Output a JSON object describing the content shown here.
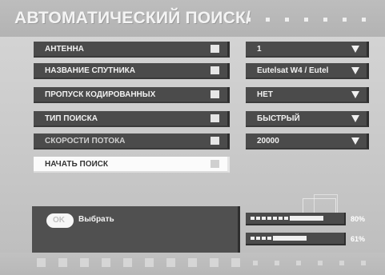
{
  "screen": {
    "title": "АВТОМАТИЧЕСКИЙ ПОИСК/"
  },
  "settings": [
    {
      "label": "АНТЕННА",
      "value": "1"
    },
    {
      "label": "НАЗВАНИЕ СПУТНИКА",
      "value": "Eutelsat W4 / Eutel"
    },
    {
      "label": "ПРОПУСК КОДИРОВАННЫХ",
      "value": "НЕТ"
    },
    {
      "label": "ТИП ПОИСКА",
      "value": "БЫСТРЫЙ"
    },
    {
      "label": "СКОРОСТИ ПОТОКА",
      "value": "20000"
    }
  ],
  "start_button": {
    "label": "НАЧАТЬ ПОИСК"
  },
  "ok_panel": {
    "ok_key": "OK",
    "action_label": "Выбрать"
  },
  "signal": {
    "strength": {
      "percent_text": "80%",
      "value": 80
    },
    "quality": {
      "percent_text": "61%",
      "value": 61
    }
  },
  "colors": {
    "panel": "#4b4b4b",
    "text_light": "#f2f2f2",
    "active_row": "#fbfbfb",
    "background": "#cfcfcf"
  }
}
